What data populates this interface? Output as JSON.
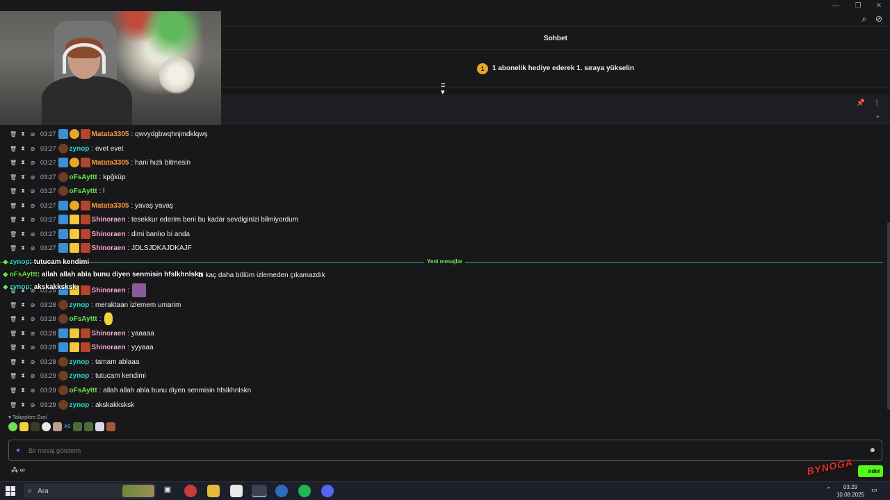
{
  "window": {
    "minimize": "—",
    "restore": "❐",
    "close": "✕"
  },
  "header": {
    "title": "Sohbet",
    "gift_badge": "1",
    "gift_text": "1 abonelik hediye ederek 1. sıraya yükselin"
  },
  "messages": [
    {
      "time": "03:27",
      "badges": [
        "blue",
        "gold",
        "red"
      ],
      "user": "Matata3305",
      "color": "orange",
      "text": ": qwvydgbwqhnjmdklqwş"
    },
    {
      "time": "03:27",
      "badges": [
        "brown"
      ],
      "user": "zynop",
      "color": "teal",
      "text": ": evet evet"
    },
    {
      "time": "03:27",
      "badges": [
        "blue",
        "gold",
        "red"
      ],
      "user": "Matata3305",
      "color": "orange",
      "text": ": hani hızlı bitmesin"
    },
    {
      "time": "03:27",
      "badges": [
        "brown"
      ],
      "user": "oFsAyttt",
      "color": "green",
      "text": ": kpğküp"
    },
    {
      "time": "03:27",
      "badges": [
        "brown"
      ],
      "user": "oFsAyttt",
      "color": "green",
      "text": ": l"
    },
    {
      "time": "03:27",
      "badges": [
        "blue",
        "gold",
        "red"
      ],
      "user": "Matata3305",
      "color": "orange",
      "text": ": yavaş yavaş"
    },
    {
      "time": "03:27",
      "badges": [
        "blue",
        "crown",
        "red"
      ],
      "user": "Shinoraen",
      "color": "pink",
      "text": ": tesekkur ederim beni bu kadar sevdiginizi bilmiyordum"
    },
    {
      "time": "03:27",
      "badges": [
        "blue",
        "crown",
        "red"
      ],
      "user": "Shinoraen",
      "color": "pink",
      "text": ": dimi banlıo bi anda"
    },
    {
      "time": "03:27",
      "badges": [
        "blue",
        "crown",
        "red"
      ],
      "user": "Shinoraen",
      "color": "pink",
      "text": ": JDLSJDKAJDKAJF"
    },
    {
      "time": "03:28",
      "badges": [
        "blue",
        "crown",
        "red"
      ],
      "user": "Shinoraen",
      "color": "pink",
      "text": ":"
    },
    {
      "time": "03:28",
      "badges": [
        "brown"
      ],
      "user": "zynop",
      "color": "teal",
      "text": ": meraktaan izlemem umarim"
    },
    {
      "time": "03:28",
      "badges": [
        "brown"
      ],
      "user": "oFsAyttt",
      "color": "green",
      "text": ":"
    },
    {
      "time": "03:28",
      "badges": [
        "blue",
        "crown",
        "red"
      ],
      "user": "Shinoraen",
      "color": "pink",
      "text": ": yaaaaa"
    },
    {
      "time": "03:28",
      "badges": [
        "blue",
        "crown",
        "red"
      ],
      "user": "Shinoraen",
      "color": "pink",
      "text": ": yyyaaa"
    },
    {
      "time": "03:28",
      "badges": [
        "brown"
      ],
      "user": "zynop",
      "color": "teal",
      "text": ": tamam ablaaa"
    },
    {
      "time": "03:29",
      "badges": [
        "brown"
      ],
      "user": "zynop",
      "color": "teal",
      "text": ": tutucam kendimi"
    },
    {
      "time": "03:29",
      "badges": [
        "brown"
      ],
      "user": "oFsAyttt",
      "color": "green",
      "text": ": allah allah abla bunu diyen senmisin hfslkhnlskn"
    },
    {
      "time": "03:29",
      "badges": [
        "brown"
      ],
      "user": "zynop",
      "color": "teal",
      "text": ": akskakksksk"
    }
  ],
  "partial_line": "bi kaç daha bölüm izlemeden çıkamazdık",
  "new_messages_label": "Yeni mesajlar",
  "overlay": [
    {
      "user": "zynop",
      "text": ": tutucam kendimi"
    },
    {
      "user": "oFsAyttt",
      "text": ": allah allah abla bunu diyen senmisin hfslkhnlskn"
    },
    {
      "user": "zynop",
      "text": ": akskakksksk"
    }
  ],
  "emotes": {
    "title": "♥ Takipçilere Özel",
    "text_emote": "AS"
  },
  "input": {
    "placeholder": "Bir mesaj gönderin"
  },
  "points": "∞",
  "send_label": "nder",
  "logo_text": "BYNOGA",
  "taskbar": {
    "search_label": "Ara",
    "time": "03:29",
    "date": "10.08.2025"
  },
  "colors": {
    "accent_green": "#53fc18",
    "background": "#18181b"
  }
}
